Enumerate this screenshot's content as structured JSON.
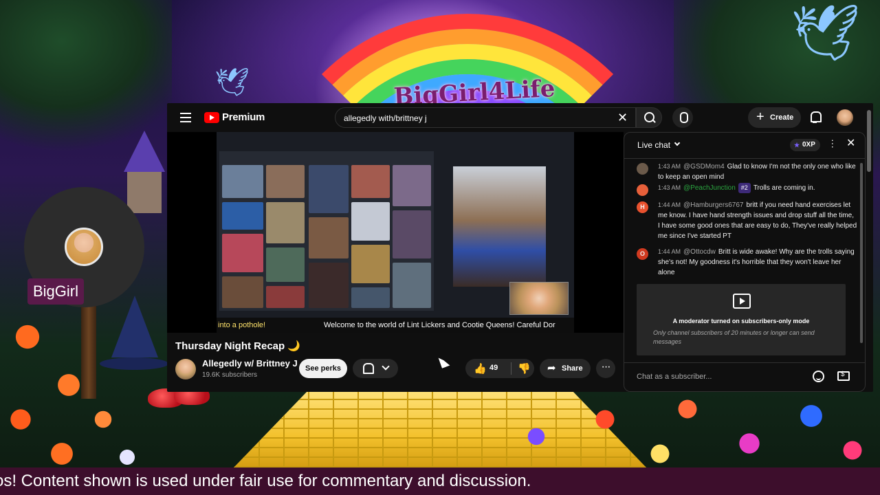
{
  "overlay": {
    "channel_title": "BigGirl4Life",
    "webcam_name": "BigGirl",
    "ticker_text": "os! Content shown is used under fair use for commentary and discussion."
  },
  "youtube": {
    "logo_text": "Premium",
    "search": {
      "value": "allegedly with/brittney j",
      "clear_icon": "close-icon",
      "search_icon": "search-icon",
      "mic_icon": "mic-icon"
    },
    "create_label": "Create",
    "video": {
      "ticker_left": "into a pothole!",
      "ticker_right": "Welcome to the world of Lint Lickers and Cootie Queens!  Careful Dor",
      "title": "Thursday Night Recap 🌙",
      "channel_name": "Allegedly w/ Brittney J",
      "subscribers": "19.6K subscribers",
      "see_perks_label": "See perks",
      "like_count": "49",
      "share_label": "Share",
      "more_label": "···"
    },
    "chat": {
      "title": "Live chat",
      "xp": "0XP",
      "messages": [
        {
          "time": "1:43 AM",
          "author": "@GSDMom4",
          "text": "Glad to know I'm not the only one who like to keep an open mind",
          "avatar_letter": "",
          "avatar_color": "#6b5a4a"
        },
        {
          "time": "1:43 AM",
          "author": "@PeachJunction",
          "badge": "#2",
          "text": "Trolls are coming in.",
          "avatar_letter": "",
          "avatar_color": "#e8603a"
        },
        {
          "time": "1:44 AM",
          "author": "@Hamburgers6767",
          "text": "britt if you need hand exercises let me know. I have hand strength issues and drop stuff all the time, I have some good ones that are easy to do, They've really helped me since I've started PT",
          "avatar_letter": "H",
          "avatar_color": "#e8512e"
        },
        {
          "time": "1:44 AM",
          "author": "@Ottocdw",
          "text": "Britt is wide awake! Why are the trolls saying she's not! My goodness it's horrible that they won't leave her alone",
          "avatar_letter": "O",
          "avatar_color": "#d0391f"
        }
      ],
      "notice_title": "A moderator turned on subscribers-only mode",
      "notice_text": "Only channel subscribers of 20 minutes or longer can send messages",
      "input_placeholder": "Chat as a subscriber..."
    }
  },
  "colors": {
    "yt_red": "#ff0000",
    "yt_bg": "#0f0f0f",
    "chat_green": "#2ba640",
    "ticker_bg": "#3d0e2c"
  }
}
